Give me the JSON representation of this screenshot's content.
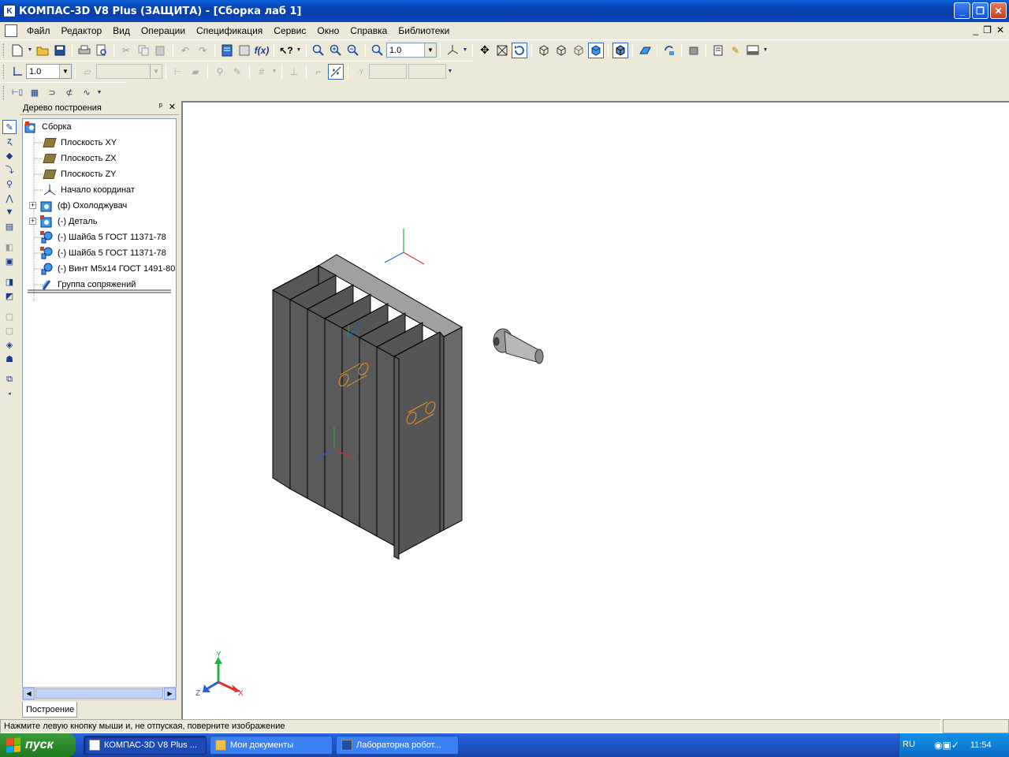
{
  "window": {
    "title": "КОМПАС-3D V8 Plus (ЗАЩИТА) - [Сборка лаб 1]",
    "minimize": "_",
    "maximize": "❐",
    "close": "✕"
  },
  "menu": {
    "items": [
      "Файл",
      "Редактор",
      "Вид",
      "Операции",
      "Спецификация",
      "Сервис",
      "Окно",
      "Справка",
      "Библиотеки"
    ],
    "mdi_min": "_",
    "mdi_restore": "❐",
    "mdi_close": "✕"
  },
  "toolbar": {
    "zoom_value": "1.0",
    "step_value": "1.0"
  },
  "tree": {
    "title": "Дерево построения",
    "pin": "ᵖ",
    "close": "✕",
    "items": [
      {
        "label": "Сборка",
        "icon": "assembly-icon"
      },
      {
        "label": "Плоскость XY",
        "icon": "plane-icon"
      },
      {
        "label": "Плоскость ZX",
        "icon": "plane-icon"
      },
      {
        "label": "Плоскость ZY",
        "icon": "plane-icon"
      },
      {
        "label": "Начало координат",
        "icon": "origin-icon"
      },
      {
        "label": "(ф) Охолоджувач",
        "icon": "part-icon"
      },
      {
        "label": "(-) Деталь",
        "icon": "part-icon"
      },
      {
        "label": "(-) Шайба 5 ГОСТ 11371-78",
        "icon": "standard-part-icon"
      },
      {
        "label": "(-) Шайба 5 ГОСТ 11371-78",
        "icon": "standard-part-icon"
      },
      {
        "label": "(-) Винт М5х14 ГОСТ 1491-80",
        "icon": "standard-part-icon"
      },
      {
        "label": "Группа сопряжений",
        "icon": "mates-icon"
      }
    ],
    "tab": "Построение"
  },
  "viewport": {
    "axis_x": "X",
    "axis_y": "Y",
    "axis_z": "Z"
  },
  "status": {
    "message": "Нажмите левую кнопку мыши и, не отпуская, поверните изображение"
  },
  "taskbar": {
    "start": "пуск",
    "tasks": [
      "КОМПАС-3D V8 Plus ...",
      "Мои документы",
      "Лабораторна робот..."
    ],
    "lang": "RU",
    "time": "11:54"
  },
  "colors": {
    "titlebar": "#0a3fa8",
    "taskbar": "#245edb",
    "start": "#2d8d2d",
    "model_face": "#5a5a5a",
    "axis_x": "#e03030",
    "axis_y": "#20b040",
    "axis_z": "#2060e0"
  }
}
